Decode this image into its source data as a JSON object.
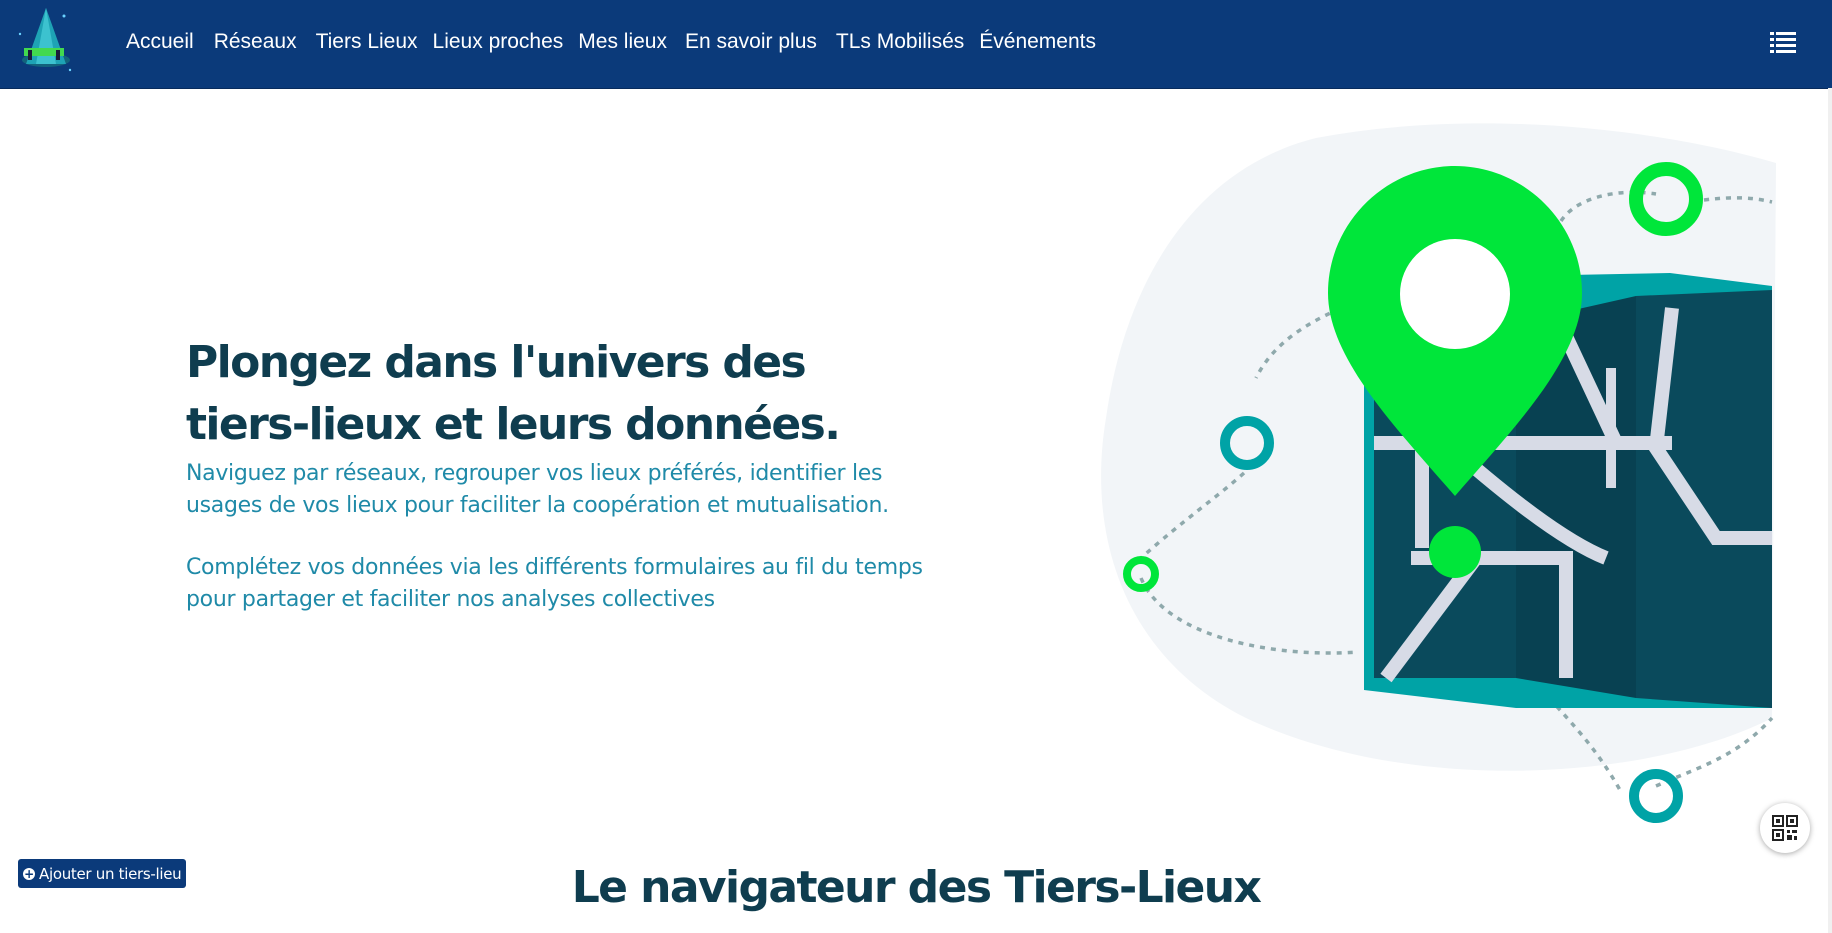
{
  "header": {
    "nav_items": [
      {
        "label": "Accueil"
      },
      {
        "label": "Réseaux"
      },
      {
        "label": "Tiers Lieux"
      },
      {
        "label": "Lieux proches"
      },
      {
        "label": "Mes lieux"
      },
      {
        "label": "En savoir plus"
      },
      {
        "label": "TLs Mobilisés"
      },
      {
        "label": "Événements"
      }
    ],
    "menu_icon": "list-icon",
    "logo_icon": "tiers-lieux-logo"
  },
  "hero": {
    "title": "Plongez dans l'univers des tiers-lieux et leurs données.",
    "paragraph1": "Naviguez par réseaux, regrouper vos lieux préférés, identifier les usages de vos lieux pour faciliter la coopération et mutualisation.",
    "paragraph2": "Complétez vos données via les différents formulaires au fil du temps pour partager et faciliter nos analyses collectives",
    "illustration_icon": "map-pin-illustration"
  },
  "floating": {
    "add_place_label": "Ajouter un tiers-lieu",
    "add_icon": "plus-circle-icon",
    "qr_icon": "qr-code-icon"
  },
  "section": {
    "title": "Le navigateur des Tiers-Lieux"
  },
  "colors": {
    "navbar": "#0b3a7a",
    "title": "#0f3d4f",
    "text": "#1f8aa8",
    "accent_green": "#00e63a",
    "accent_teal": "#00a3a6"
  }
}
